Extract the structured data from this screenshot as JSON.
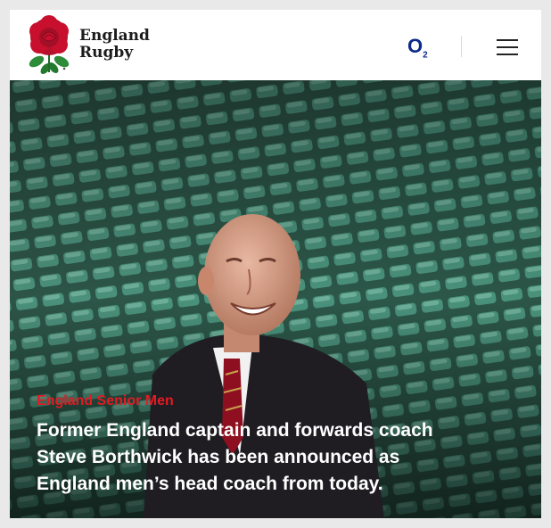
{
  "brand": {
    "line1": "England",
    "line2": "Rugby",
    "logo_icon": "red-rose-icon"
  },
  "header": {
    "sponsor": {
      "main": "O",
      "sub": "2"
    },
    "menu_icon": "hamburger-menu-icon"
  },
  "hero": {
    "category": "England Senior Men",
    "headline": "Former England captain and forwards coach\nSteve Borthwick has been announced as\nEngland men’s head coach from today."
  },
  "colors": {
    "accent_red": "#e31b23",
    "sponsor_blue": "#0b2a8a",
    "seat_green": "#3d8a73"
  }
}
